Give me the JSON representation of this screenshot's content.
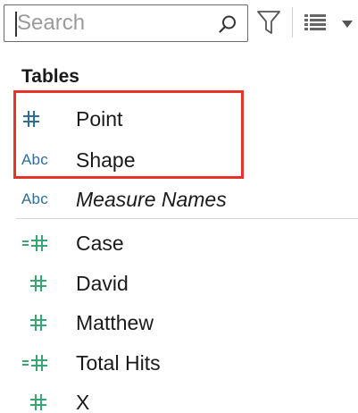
{
  "search": {
    "placeholder": "Search",
    "value": ""
  },
  "toolbar": {
    "search_icon": "search-icon",
    "filter_icon": "filter-icon",
    "view_icon": "list-view-icon",
    "dropdown_icon": "chevron-down-icon"
  },
  "section": {
    "title": "Tables"
  },
  "dimensions": [
    {
      "name": "Point",
      "type": "number",
      "icon": "#",
      "color": "#2e6f99"
    },
    {
      "name": "Shape",
      "type": "string",
      "icon": "Abc",
      "color": "#2e6f99"
    },
    {
      "name": "Measure Names",
      "type": "string",
      "icon": "Abc",
      "color": "#2e6f99",
      "italic": true
    }
  ],
  "measures": [
    {
      "name": "Case",
      "type": "calculated-number",
      "icon": "=#",
      "color": "#3aa573"
    },
    {
      "name": "David",
      "type": "number",
      "icon": "#",
      "color": "#3aa573"
    },
    {
      "name": "Matthew",
      "type": "number",
      "icon": "#",
      "color": "#3aa573"
    },
    {
      "name": "Total Hits",
      "type": "calculated-number",
      "icon": "=#",
      "color": "#3aa573"
    },
    {
      "name": "X",
      "type": "number",
      "icon": "#",
      "color": "#3aa573"
    }
  ],
  "highlight_color": "#e8322a"
}
